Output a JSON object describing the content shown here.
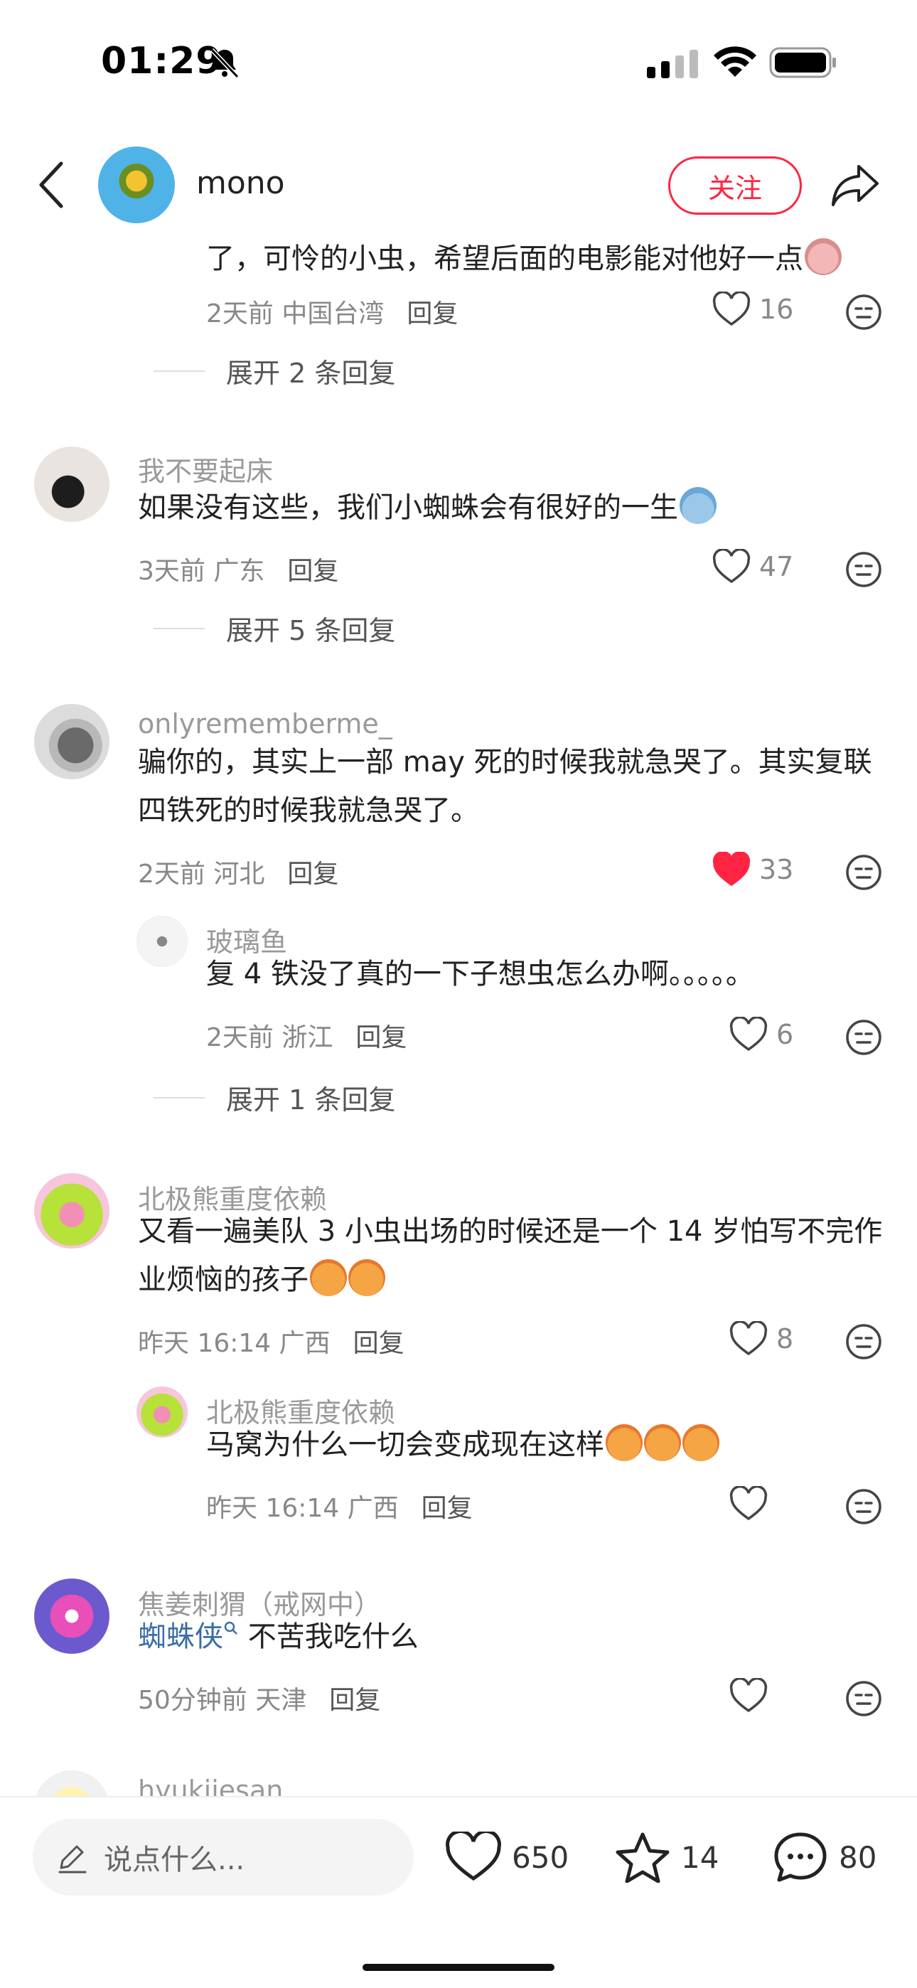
{
  "status_bar": {
    "time": "01:29"
  },
  "header": {
    "username": "mono",
    "follow_label": "关注"
  },
  "comments": {
    "c0": {
      "text": "了，可怜的小虫，希望后面的电影能对他好一点",
      "time": "2天前",
      "location": "中国台湾",
      "reply": "回复",
      "likes": "16",
      "expand": "展开 2 条回复"
    },
    "c1": {
      "name": "我不要起床",
      "text": "如果没有这些，我们小蜘蛛会有很好的一生",
      "time": "3天前",
      "location": "广东",
      "reply": "回复",
      "likes": "47",
      "expand": "展开 5 条回复"
    },
    "c2": {
      "name": "onlyrememberme_",
      "text_line1": "骗你的，其实上一部 may 死的时候我就急哭了。其实复联",
      "text_line2": "四铁死的时候我就急哭了。",
      "time": "2天前",
      "location": "河北",
      "reply": "回复",
      "likes": "33",
      "sub": {
        "name": "玻璃鱼",
        "text": "复 4 铁没了真的一下子想虫怎么办啊。。。。。",
        "time": "2天前",
        "location": "浙江",
        "reply": "回复",
        "likes": "6"
      },
      "expand": "展开 1 条回复"
    },
    "c3": {
      "name": "北极熊重度依赖",
      "text_line1": "又看一遍美队 3 小虫出场的时候还是一个 14 岁怕写不完作",
      "text_line2": "业烦恼的孩子",
      "time": "昨天 16:14",
      "location": "广西",
      "reply": "回复",
      "likes": "8",
      "sub": {
        "name": "北极熊重度依赖",
        "text": "马窝为什么一切会变成现在这样",
        "time": "昨天 16:14",
        "location": "广西",
        "reply": "回复"
      }
    },
    "c4": {
      "name": "焦姜刺猬（戒网中）",
      "mention": "蜘蛛侠",
      "text": " 不苦我吃什么",
      "time": "50分钟前",
      "location": "天津",
      "reply": "回复"
    },
    "c5": {
      "name": "hyukiiesan"
    }
  },
  "bottom_bar": {
    "input_placeholder": "说点什么...",
    "likes": "650",
    "favorites": "14",
    "comments": "80"
  },
  "colors": {
    "accent": "#ff2442",
    "mention": "#3a6ea5",
    "muted": "#999999"
  }
}
